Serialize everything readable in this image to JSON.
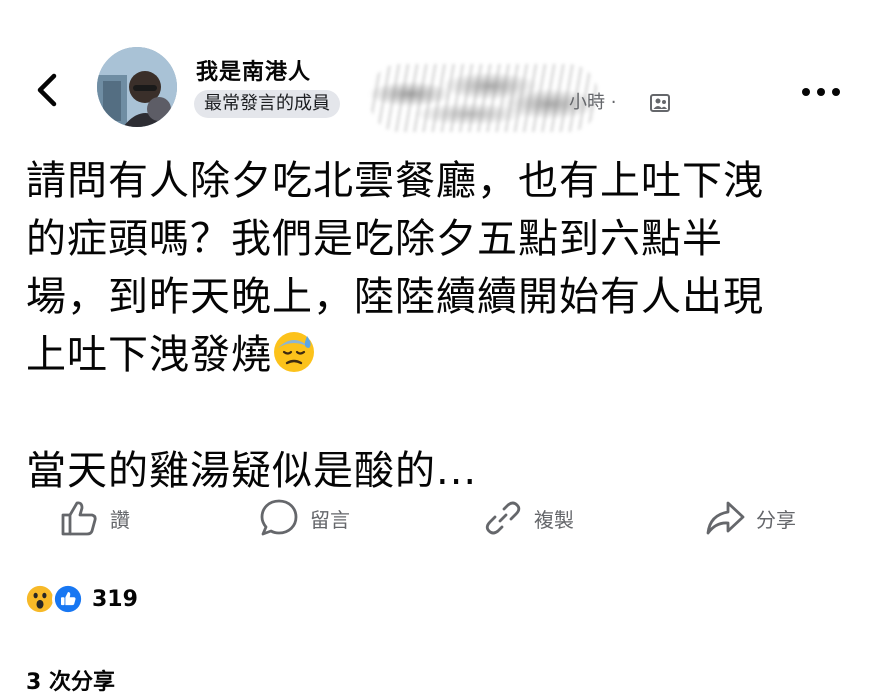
{
  "header": {
    "author_name": "我是南港人",
    "badge": "最常發言的成員",
    "time": "小時 ·",
    "back_icon": "chevron-left-icon",
    "more_icon": "more-horizontal-icon",
    "audience_icon": "group-members-icon"
  },
  "post": {
    "lines": [
      "請問有人除夕吃北雲餐廳，也有上吐下洩",
      "的症頭嗎？我們是吃除夕五點到六點半",
      "場，到昨天晚上，陸陸續續開始有人出現",
      "上吐下洩發燒"
    ],
    "emoji": "downcast-face-with-sweat-emoji",
    "last_paragraph": "當天的雞湯疑似是酸的..."
  },
  "actions": {
    "like_label": "讚",
    "comment_label": "留言",
    "copy_label": "複製",
    "share_label": "分享"
  },
  "stats": {
    "reaction_count": "319",
    "reaction_icons": [
      "wow-reaction-icon",
      "like-reaction-icon"
    ],
    "shares": "3 次分享"
  },
  "colors": {
    "text": "#050505",
    "secondary_text": "#65676b",
    "badge_bg": "#e4e6eb",
    "like_blue": "#1877f2",
    "wow_yellow": "#f7b928"
  }
}
